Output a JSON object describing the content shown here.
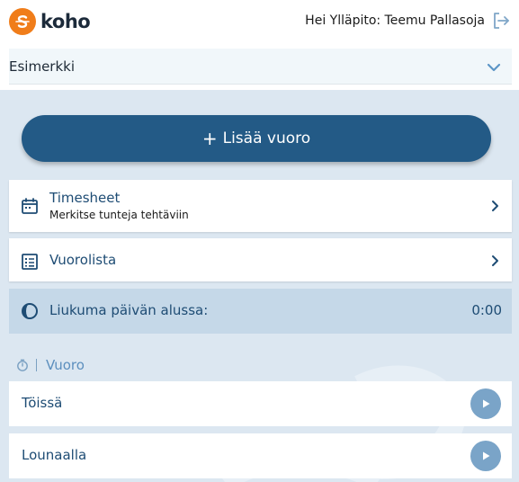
{
  "header": {
    "logo_text": "koho",
    "greeting": "Hei Ylläpito: Teemu Pallasoja",
    "logout_icon": "logout-icon"
  },
  "selector": {
    "value": "Esimerkki",
    "icon": "chevron-down-icon"
  },
  "actions": {
    "add_shift_label": "Lisää vuoro"
  },
  "cards": [
    {
      "title": "Timesheet",
      "subtitle": "Merkitse tunteja tehtäviin",
      "icon": "calendar-icon"
    },
    {
      "title": "Vuorolista",
      "icon": "list-icon"
    }
  ],
  "flex_status": {
    "label": "Liukuma päivän alussa:",
    "value": "0:00",
    "icon": "half-moon-icon"
  },
  "shift_section": {
    "label": "Vuoro",
    "icon": "stopwatch-icon",
    "items": [
      {
        "label": "Töissä"
      },
      {
        "label": "Lounaalla"
      }
    ]
  },
  "colors": {
    "brand_orange": "#f07d1a",
    "primary": "#235a86",
    "text_primary": "#1e4c74",
    "background": "#dce7f1",
    "status_bg": "#c5d8e8",
    "play_button": "#7aa4c8"
  }
}
